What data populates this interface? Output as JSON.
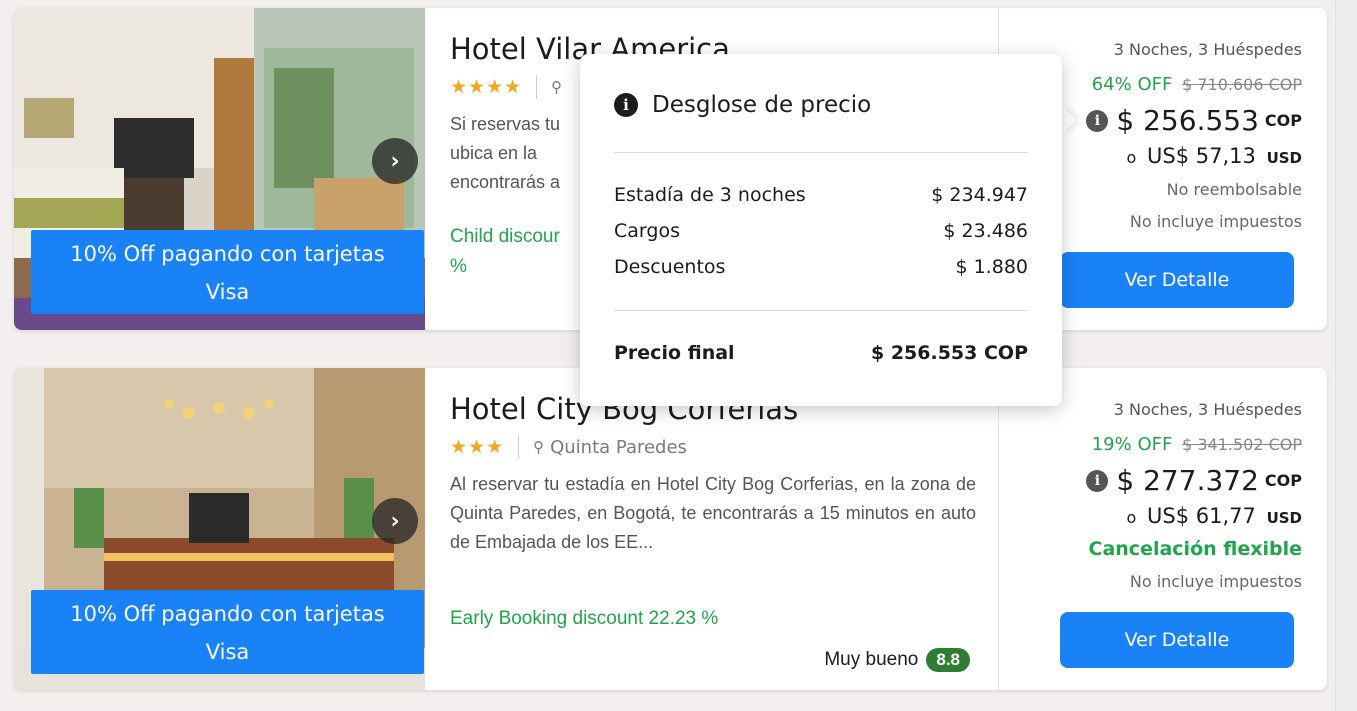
{
  "hotels": [
    {
      "name": "Hotel Vilar America",
      "stars": "★★★★",
      "location": "",
      "description": "Si reservas tu ... ubica en la ... encontrarás a ...",
      "desc_lines": [
        "Si reservas tu",
        "ubica en la",
        "encontrarás a"
      ],
      "discount_text": "Child discour",
      "discount_text_line2": "%",
      "promo_line1": "10% Off pagando con tarjetas",
      "promo_line2": "Visa",
      "nights_guests": "3 Noches, 3 Huéspedes",
      "off_pct": "64% OFF",
      "old_price": "$ 710.606 COP",
      "price": "$ 256.553",
      "price_currency": "COP",
      "usd_prefix": "o",
      "usd_price": "US$ 57,13",
      "usd_currency": "USD",
      "policy": "No reembolsable",
      "tax_note": "No incluye impuestos",
      "button_label": "Ver Detalle"
    },
    {
      "name": "Hotel City Bog Corferias",
      "stars": "★★★",
      "location": "Quinta Paredes",
      "description": "Al reservar tu estadía en Hotel City Bog Corferias, en la zona de Quinta Paredes, en Bogotá, te encontrarás a 15 minutos en auto de Embajada de los EE...",
      "discount_text": "Early Booking discount 22.23 %",
      "review_label": "Muy bueno",
      "review_score": "8.8",
      "promo_line1": "10% Off pagando con tarjetas",
      "promo_line2": "Visa",
      "nights_guests": "3 Noches, 3 Huéspedes",
      "off_pct": "19% OFF",
      "old_price": "$ 341.502 COP",
      "price": "$ 277.372",
      "price_currency": "COP",
      "usd_prefix": "o",
      "usd_price": "US$ 61,77",
      "usd_currency": "USD",
      "policy": "Cancelación flexible",
      "tax_note": "No incluye impuestos",
      "button_label": "Ver Detalle"
    }
  ],
  "popover": {
    "title": "Desglose de precio",
    "rows": [
      {
        "label": "Estadía de 3 noches",
        "value": "$ 234.947"
      },
      {
        "label": "Cargos",
        "value": "$ 23.486"
      },
      {
        "label": "Descuentos",
        "value": "$ 1.880"
      }
    ],
    "final_label": "Precio final",
    "final_value": "$ 256.553 COP"
  },
  "icons": {
    "info": "info-circle-icon",
    "pin": "map-pin-icon",
    "next": "chevron-right-icon"
  },
  "colors": {
    "primary": "#1a82f7",
    "green": "#1fa64a",
    "star": "#f5a623",
    "score_bg": "#2e7d32"
  }
}
